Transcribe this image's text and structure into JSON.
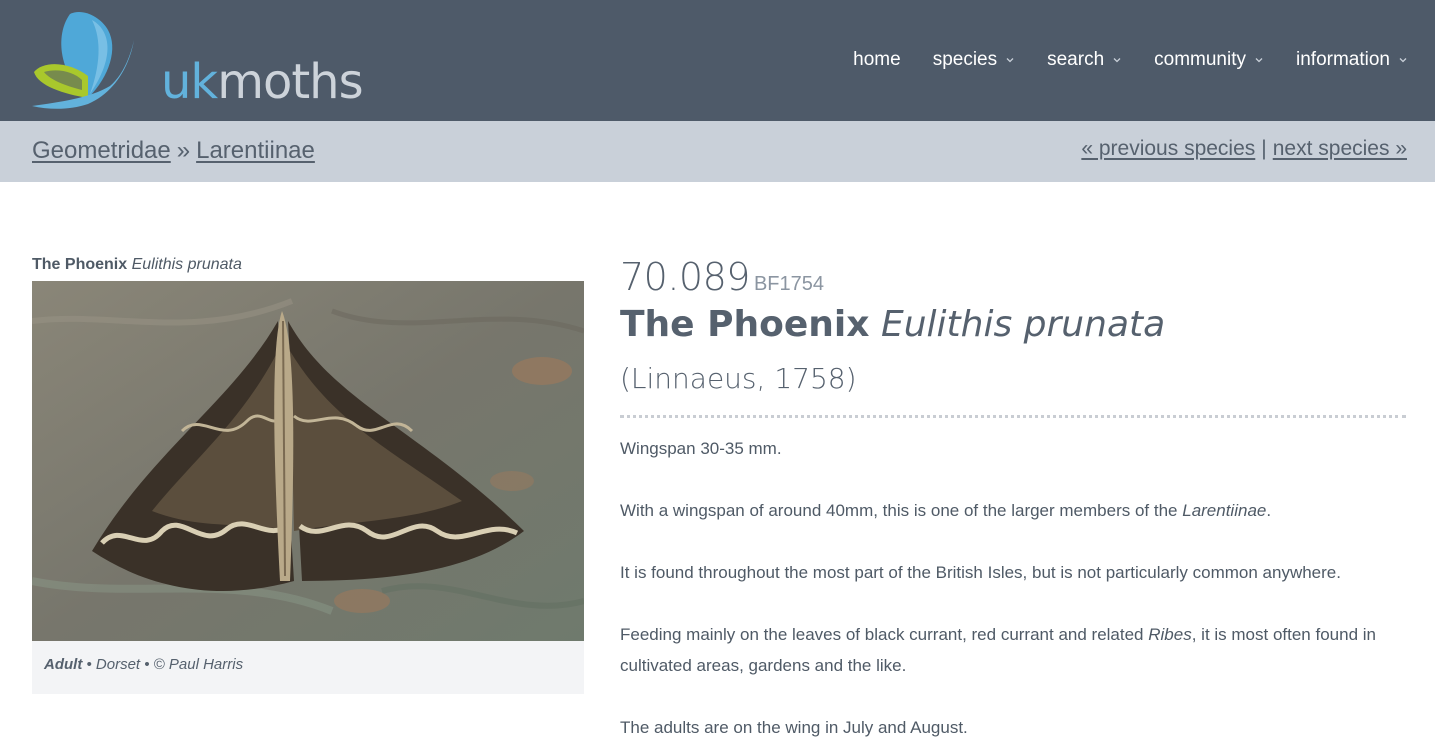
{
  "header": {
    "logo": {
      "uk": "uk",
      "moths": "moths"
    },
    "nav": [
      {
        "label": "home",
        "dropdown": false
      },
      {
        "label": "species",
        "dropdown": true
      },
      {
        "label": "search",
        "dropdown": true
      },
      {
        "label": "community",
        "dropdown": true
      },
      {
        "label": "information",
        "dropdown": true
      }
    ]
  },
  "breadcrumb": {
    "family": "Geometridae",
    "separator": "»",
    "subfamily": "Larentiinae"
  },
  "pager": {
    "previous": "« previous species",
    "divider": "|",
    "next": "next species »"
  },
  "photo": {
    "caption_common": "The Phoenix",
    "caption_latin": "Eulithis prunata",
    "stage": "Adult",
    "credit": " • Dorset • © Paul Harris"
  },
  "species": {
    "code": "70.089",
    "bf_code": "BF1754",
    "common_name": "The Phoenix",
    "latin_name": "Eulithis prunata",
    "authority": "(Linnaeus, 1758)"
  },
  "description": {
    "p1": "Wingspan 30-35 mm.",
    "p2_before": "With a wingspan of around 40mm, this is one of the larger members of the ",
    "p2_italic": "Larentiinae",
    "p2_after": ".",
    "p3": "It is found throughout the most part of the British Isles, but is not particularly common anywhere.",
    "p4_before": "Feeding mainly on the leaves of black currant, red currant and related ",
    "p4_italic": "Ribes",
    "p4_after": ", it is most often found in cultivated areas, gardens and the like.",
    "p5": "The adults are on the wing in July and August."
  },
  "colors": {
    "header_bg": "#4e5a69",
    "crumb_bg": "#c9d0d9",
    "logo_blue": "#62b2dc",
    "logo_green": "#a9c82c",
    "text": "#4f5a66"
  },
  "icons": {
    "logo": "butterfly-logo-icon",
    "dropdown": "chevron-down-icon"
  }
}
